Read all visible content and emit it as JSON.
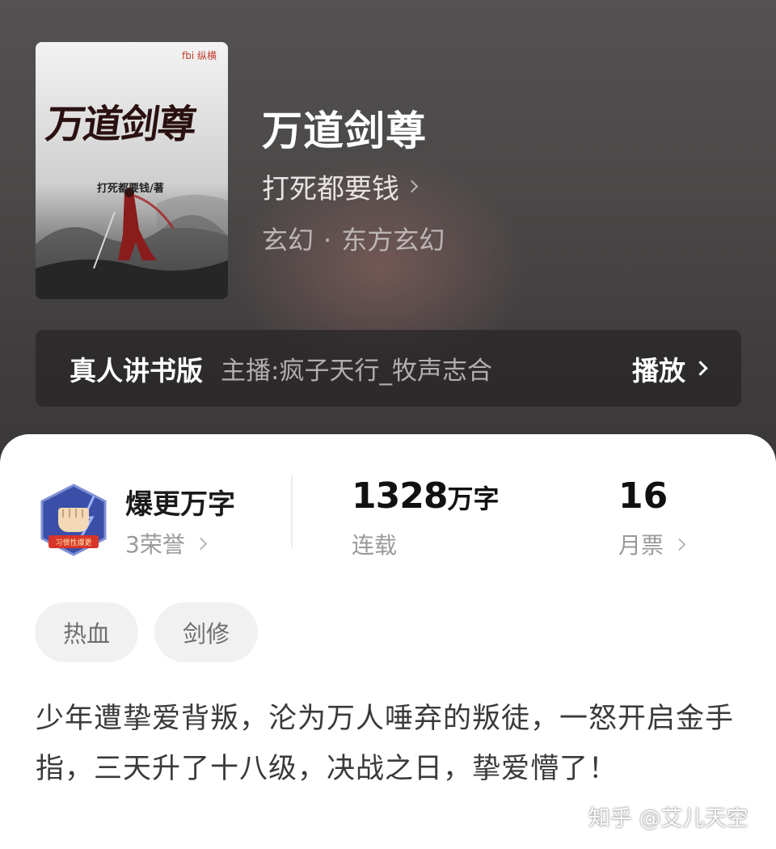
{
  "book": {
    "title": "万道剑尊",
    "author": "打死都要钱",
    "genre_primary": "玄幻",
    "genre_separator": "·",
    "genre_secondary": "东方玄幻"
  },
  "cover": {
    "publisher_mark": "fbi 纵横",
    "title_text": "万道剑尊",
    "author_text": "打死都要钱/著"
  },
  "audio": {
    "label": "真人讲书版",
    "host": "主播:疯子天行_牧声志合",
    "play_label": "播放"
  },
  "stats": {
    "honor_title": "爆更万字",
    "honor_count": "3荣誉",
    "badge_text": "习惯性爆更",
    "word_count": "1328",
    "word_unit": "万字",
    "status": "连载",
    "monthly_tickets": "16",
    "tickets_label": "月票"
  },
  "tags": [
    "热血",
    "剑修"
  ],
  "description": "少年遭挚爱背叛，沦为万人唾弃的叛徒，一怒开启金手指，三天升了十八级，决战之日，挚爱懵了！",
  "watermark": "知乎 @艾儿天空",
  "colors": {
    "hero_bg": "#4b4848",
    "accent_badge": "#3b4fa8",
    "text_primary": "#1a1a1a",
    "text_secondary": "#9a9a9a",
    "tag_bg": "#f1f1f1"
  }
}
